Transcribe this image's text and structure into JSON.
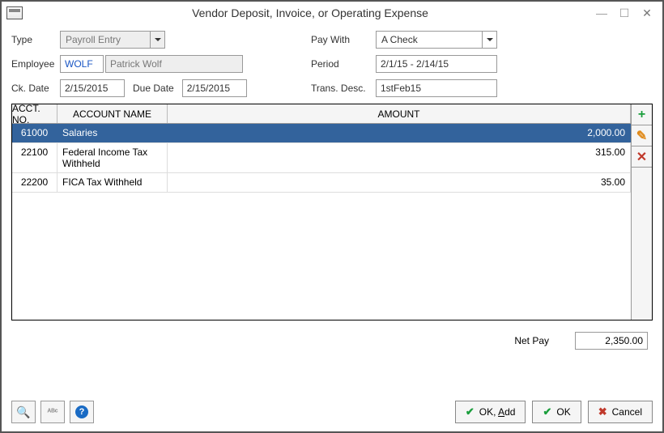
{
  "window": {
    "title": "Vendor Deposit, Invoice, or Operating Expense"
  },
  "form": {
    "type_label": "Type",
    "type_value": "Payroll Entry",
    "paywith_label": "Pay With",
    "paywith_value": "A Check",
    "employee_label": "Employee",
    "employee_code": "WOLF",
    "employee_name": "Patrick Wolf",
    "period_label": "Period",
    "period_value": "2/1/15 - 2/14/15",
    "ckdate_label": "Ck. Date",
    "ckdate_value": "2/15/2015",
    "duedate_label": "Due Date",
    "duedate_value": "2/15/2015",
    "transdesc_label": "Trans. Desc.",
    "transdesc_value": "1stFeb15"
  },
  "gridHeaders": {
    "acct": "ACCT. NO.",
    "name": "ACCOUNT NAME",
    "amt": "AMOUNT"
  },
  "rows": [
    {
      "acct": "61000",
      "name": "Salaries",
      "amount": "2,000.00",
      "selected": true
    },
    {
      "acct": "22100",
      "name": "Federal Income Tax Withheld",
      "amount": "315.00",
      "selected": false
    },
    {
      "acct": "22200",
      "name": "FICA Tax Withheld",
      "amount": "35.00",
      "selected": false
    }
  ],
  "netpay": {
    "label": "Net Pay",
    "value": "2,350.00"
  },
  "buttons": {
    "ok_add_pre": "OK, ",
    "ok_add_u": "A",
    "ok_add_post": "dd",
    "ok": "OK",
    "cancel": "Cancel"
  }
}
